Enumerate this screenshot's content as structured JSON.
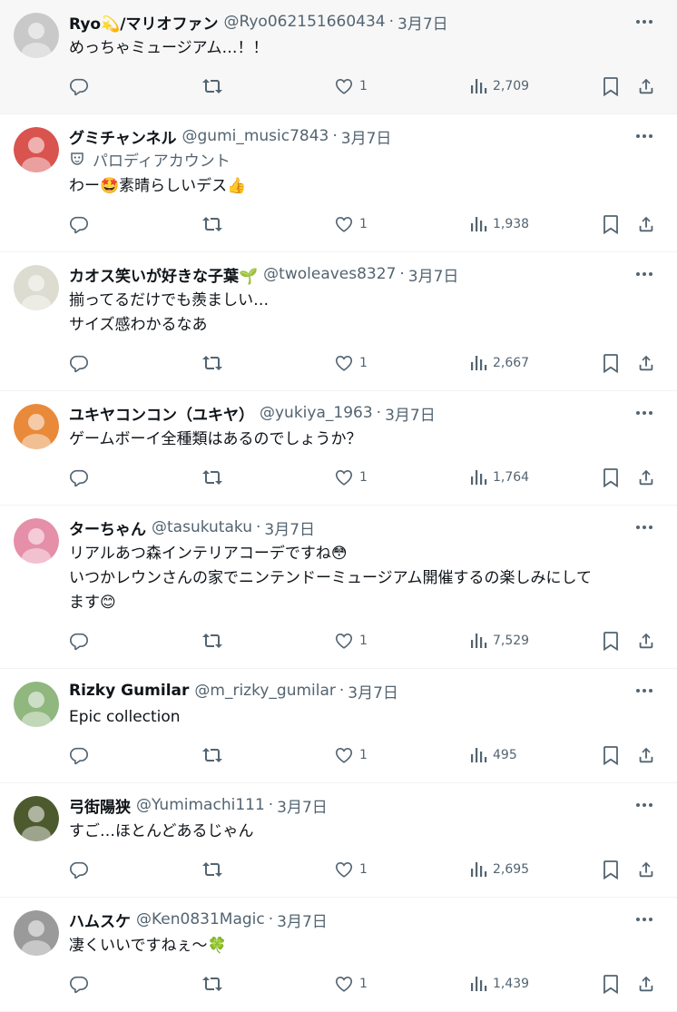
{
  "tweets": [
    {
      "name": "Ryo💫/マリオファン",
      "handle": "@Ryo062151660434",
      "date": "3月7日",
      "badge": "",
      "text": [
        "めっちゃミュージアム…！！"
      ],
      "likes": "1",
      "views": "2,709",
      "avatar_color": "#c9c9c9"
    },
    {
      "name": "グミチャンネル",
      "handle": "@gumi_music7843",
      "date": "3月7日",
      "badge": "パロディアカウント",
      "text": [
        "わー🤩素晴らしいデス👍"
      ],
      "likes": "1",
      "views": "1,938",
      "avatar_color": "#d9534f"
    },
    {
      "name": "カオス笑いが好きな子葉🌱",
      "handle": "@twoleaves8327",
      "date": "3月7日",
      "badge": "",
      "text": [
        "揃ってるだけでも羨ましい…",
        "サイズ感わかるなあ"
      ],
      "likes": "1",
      "views": "2,667",
      "avatar_color": "#dcdcd0"
    },
    {
      "name": "ユキヤコンコン（ユキヤ）",
      "handle": "@yukiya_1963",
      "date": "3月7日",
      "badge": "",
      "text": [
        "ゲームボーイ全種類はあるのでしょうか？"
      ],
      "likes": "1",
      "views": "1,764",
      "avatar_color": "#e88a3a"
    },
    {
      "name": "ターちゃん",
      "handle": "@tasukutaku",
      "date": "3月7日",
      "badge": "",
      "text": [
        "リアルあつ森インテリアコーデですね😳",
        "いつかレウンさんの家でニンテンドーミュージアム開催するの楽しみにして",
        "ます😊"
      ],
      "likes": "1",
      "views": "7,529",
      "avatar_color": "#e58fa8"
    },
    {
      "name": "Rizky Gumilar",
      "handle": "@m_rizky_gumilar",
      "date": "3月7日",
      "badge": "",
      "text": [
        "Epic collection"
      ],
      "likes": "1",
      "views": "495",
      "avatar_color": "#8fb77e"
    },
    {
      "name": "弓街陽狭",
      "handle": "@Yumimachi111",
      "date": "3月7日",
      "badge": "",
      "text": [
        "すご…ほとんどあるじゃん"
      ],
      "likes": "1",
      "views": "2,695",
      "avatar_color": "#4d5a2e"
    },
    {
      "name": "ハムスケ",
      "handle": "@Ken0831Magic",
      "date": "3月7日",
      "badge": "",
      "text": [
        "凄くいいですねぇ～🍀"
      ],
      "likes": "1",
      "views": "1,439",
      "avatar_color": "#9a9a9a"
    }
  ],
  "icons": {
    "reply": "reply-icon",
    "retweet": "retweet-icon",
    "like": "heart-icon",
    "views": "views-icon",
    "bookmark": "bookmark-icon",
    "share": "share-icon",
    "more": "more-icon",
    "badge": "parody-mask-icon"
  },
  "colors": {
    "text": "#0f1419",
    "muted": "#536471",
    "divider": "#eff3f4",
    "highlight_bg": "#f7f7f7"
  }
}
